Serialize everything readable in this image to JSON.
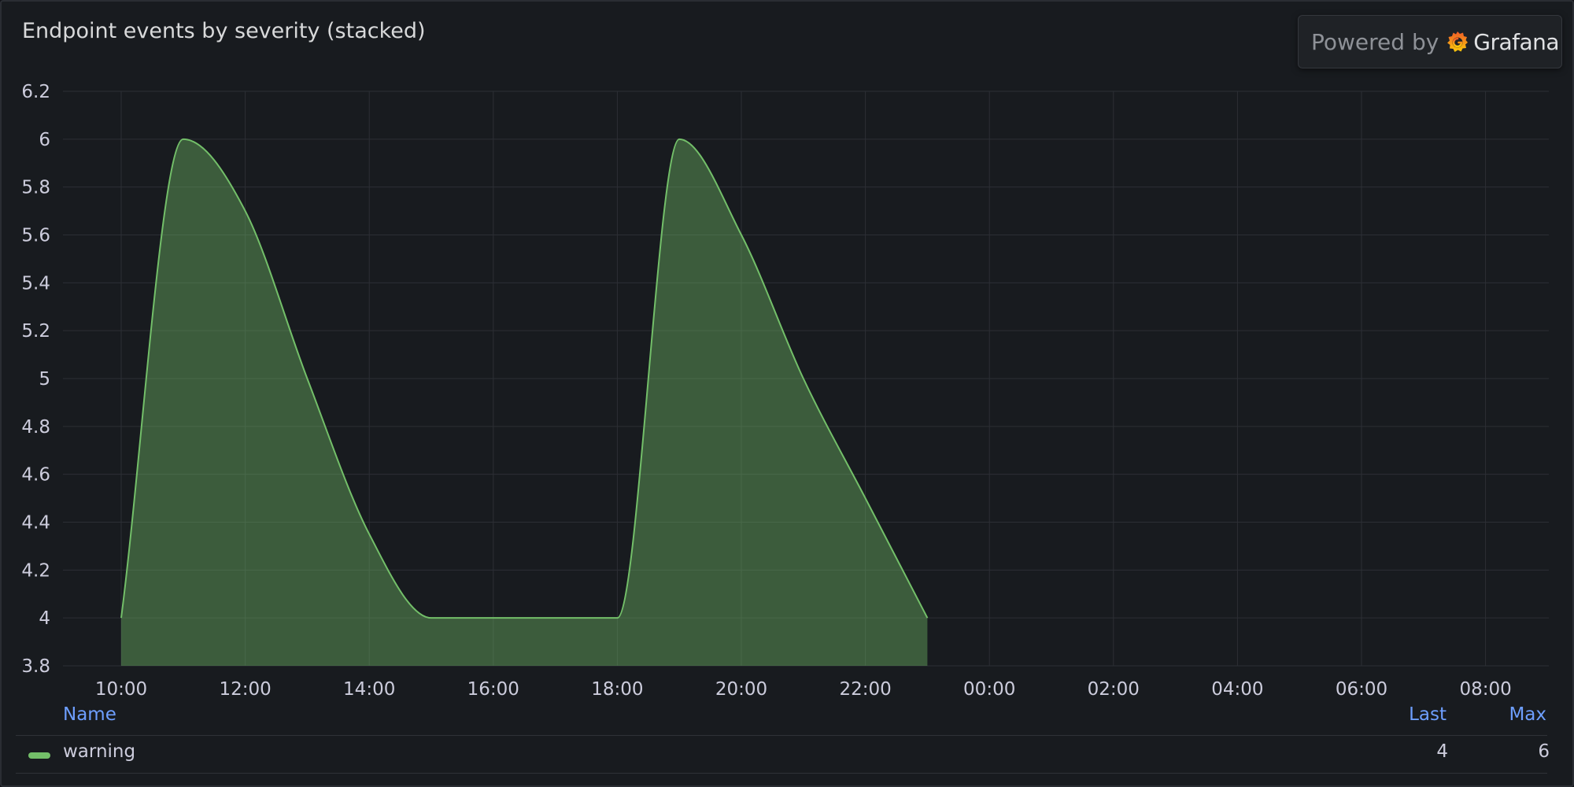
{
  "panel": {
    "title": "Endpoint events by severity (stacked)",
    "powered_by": "Powered by",
    "brand": "Grafana"
  },
  "colors": {
    "background": "#181b1f",
    "series_line": "#73bf69",
    "series_fill": "#73bf69",
    "grid": "#2c2f35",
    "legend_header": "#6e9fff"
  },
  "icons": {
    "brand_logo": "grafana-logo-icon"
  },
  "chart_data": {
    "type": "area",
    "title": "Endpoint events by severity (stacked)",
    "xlabel": "",
    "ylabel": "",
    "x_ticks": [
      "10:00",
      "12:00",
      "14:00",
      "16:00",
      "18:00",
      "20:00",
      "22:00",
      "00:00",
      "02:00",
      "04:00",
      "06:00",
      "08:00"
    ],
    "y_ticks": [
      3.8,
      4,
      4.2,
      4.4,
      4.6,
      4.8,
      5,
      5.2,
      5.4,
      5.6,
      5.8,
      6,
      6.2
    ],
    "xlim": [
      "09:00",
      "09:00 (+1d)"
    ],
    "ylim": [
      3.8,
      6.2
    ],
    "grid": true,
    "stacked": true,
    "smooth": true,
    "legend_placement": "bottom",
    "x": [
      "10:00",
      "11:00",
      "12:00",
      "13:00",
      "14:00",
      "15:00",
      "16:00",
      "17:00",
      "18:00",
      "19:00",
      "20:00",
      "21:00",
      "22:00",
      "23:00"
    ],
    "series": [
      {
        "name": "warning",
        "values": [
          4,
          6,
          5.7,
          5.0,
          4.35,
          4,
          4,
          4,
          4,
          6,
          5.6,
          5.0,
          4.5,
          4
        ]
      }
    ]
  },
  "legend": {
    "headers": {
      "name": "Name",
      "last": "Last",
      "max": "Max"
    },
    "rows": [
      {
        "name": "warning",
        "last": "4",
        "max": "6"
      }
    ]
  }
}
